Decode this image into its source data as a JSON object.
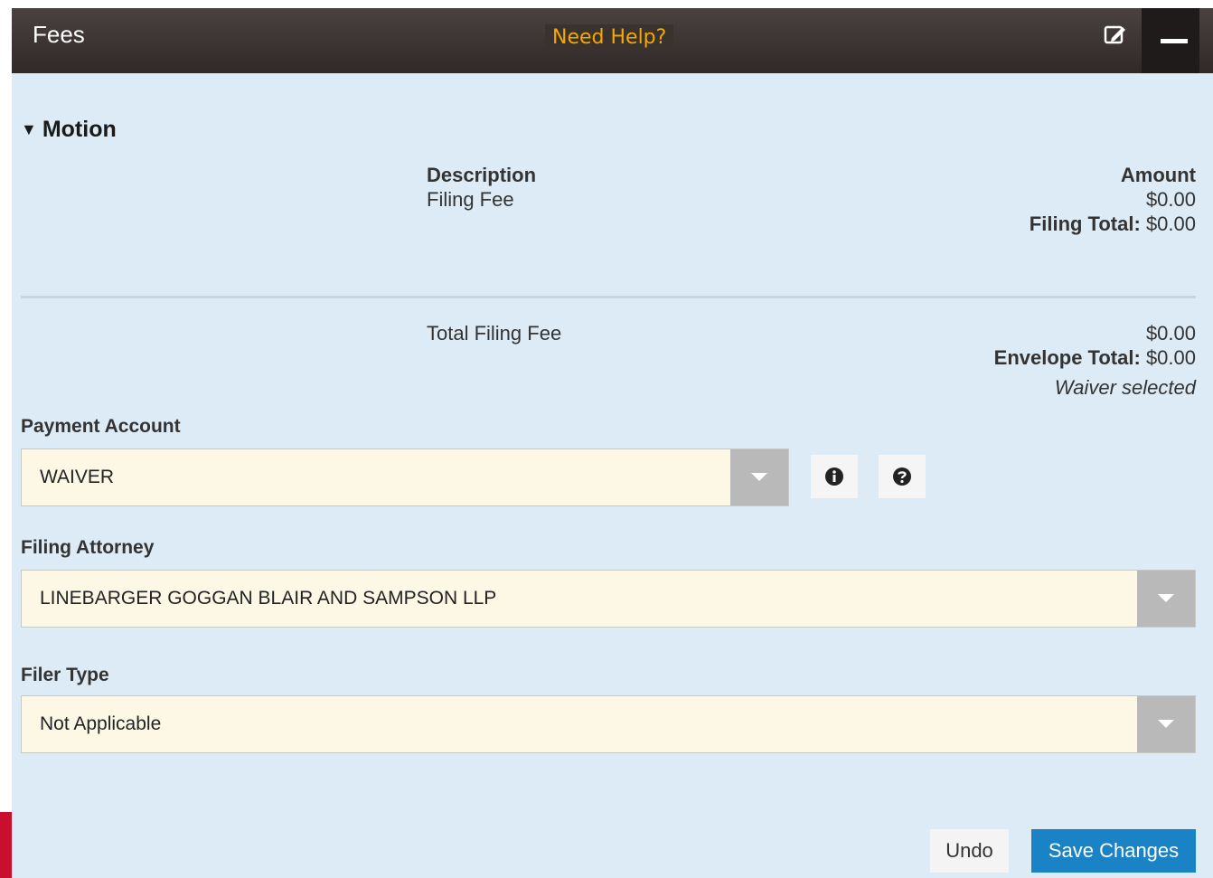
{
  "header": {
    "title": "Fees",
    "help_link": "Need Help?"
  },
  "section": {
    "title": "Motion",
    "description_header": "Description",
    "amount_header": "Amount",
    "fee_items": [
      {
        "description": "Filing Fee",
        "amount": "$0.00"
      }
    ],
    "filing_total_label": "Filing Total:",
    "filing_total_value": "$0.00"
  },
  "totals": {
    "total_filing_fee_label": "Total Filing Fee",
    "total_filing_fee_value": "$0.00",
    "envelope_total_label": "Envelope Total:",
    "envelope_total_value": "$0.00",
    "waiver_note": "Waiver selected"
  },
  "payment_account": {
    "label": "Payment Account",
    "value": "WAIVER"
  },
  "filing_attorney": {
    "label": "Filing Attorney",
    "value": "LINEBARGER GOGGAN BLAIR AND SAMPSON LLP"
  },
  "filer_type": {
    "label": "Filer Type",
    "value": "Not Applicable"
  },
  "actions": {
    "undo_label": "Undo",
    "save_label": "Save Changes"
  },
  "icons": {
    "edit": "edit-icon",
    "minimize": "minimize-icon",
    "info": "info-icon",
    "help": "help-icon",
    "caret": "caret-down-icon",
    "dropdown": "chevron-down-icon"
  },
  "colors": {
    "header_background": "#2f2927",
    "help_link": "#f5a800",
    "panel_background": "#dcebf6",
    "select_background": "#fdf8e6",
    "primary_button": "#1a83c6",
    "accent_red": "#c8102e"
  }
}
